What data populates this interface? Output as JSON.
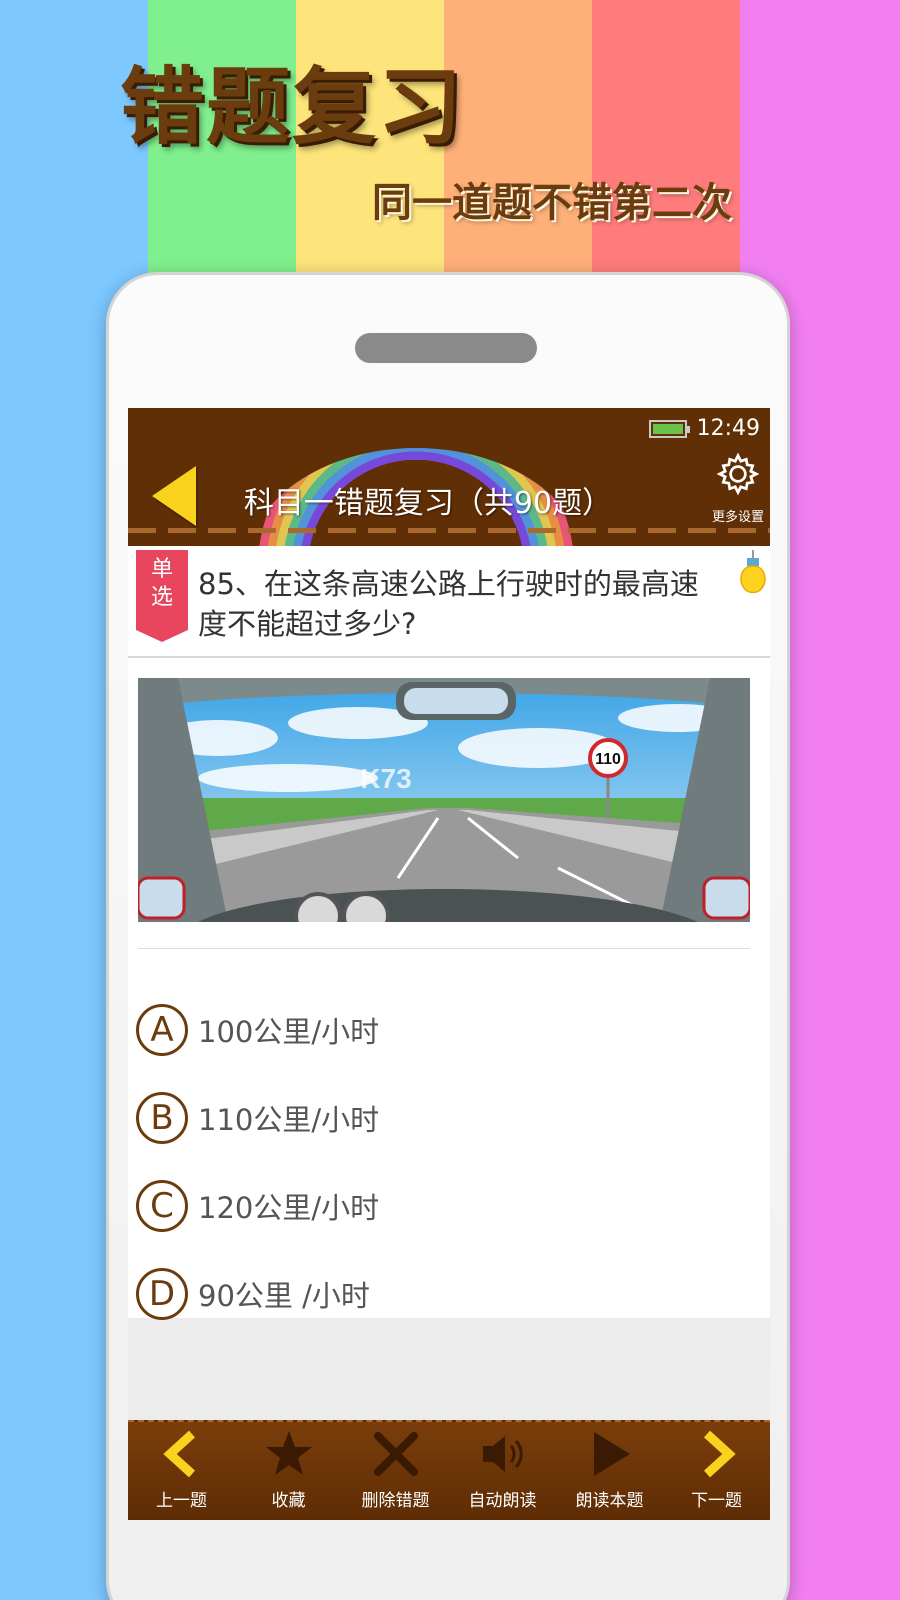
{
  "stripe_colors": [
    "#7cc8ff",
    "#80f08e",
    "#fde47b",
    "#ffb078",
    "#ff7c7c",
    "#f27ff2"
  ],
  "banner": {
    "title": "错题复习",
    "subtitle": "同一道题不错第二次"
  },
  "status": {
    "time": "12:49",
    "battery_icon": "battery-charging-icon"
  },
  "header": {
    "title": "科目一错题复习（共90题）",
    "settings_label": "更多设置",
    "back_icon": "back-arrow-icon",
    "settings_icon": "gear-icon",
    "hint_icon": "lightbulb-icon"
  },
  "question": {
    "type_label": "单选",
    "text": "85、在这条高速公路上行驶时的最高速度不能超过多少?",
    "speed_sign": "110",
    "watermark_text": "K73",
    "options": [
      {
        "letter": "A",
        "text": "100公里/小时"
      },
      {
        "letter": "B",
        "text": "110公里/小时"
      },
      {
        "letter": "C",
        "text": "120公里/小时"
      },
      {
        "letter": "D",
        "text": "90公里 /小时"
      }
    ]
  },
  "toolbar": {
    "prev": "上一题",
    "favorite": "收藏",
    "delete": "删除错题",
    "auto_read": "自动朗读",
    "read_this": "朗读本题",
    "next": "下一题"
  },
  "colors": {
    "brown": "#612f06",
    "accent_yellow": "#f8d21c",
    "tag_red": "#e8455f"
  }
}
